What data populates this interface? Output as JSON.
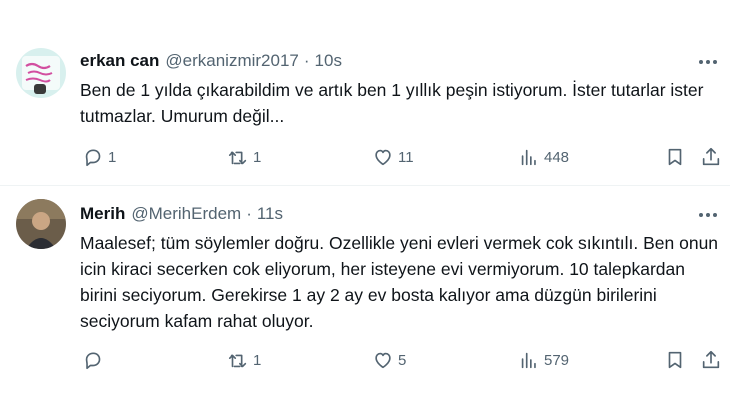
{
  "tweets": [
    {
      "author_name": "erkan can",
      "handle": "@erkanizmir2017",
      "separator": "·",
      "time": "10s",
      "text": "Ben de 1 yılda çıkarabildim ve artık ben 1 yıllık peşin istiyorum. İster tutarlar ister tutmazlar. Umurum değil...",
      "replies": "1",
      "retweets": "1",
      "likes": "11",
      "views": "448"
    },
    {
      "author_name": "Merih",
      "handle": "@MerihErdem",
      "separator": "·",
      "time": "11s",
      "text": "Maalesef; tüm söylemler doğru. Ozellikle yeni evleri vermek cok sıkıntılı. Ben onun icin kiraci secerken cok eliyorum, her isteyene evi vermiyorum. 10 talepkardan birini seciyorum. Gerekirse 1 ay 2 ay ev bosta kalıyor ama düzgün birilerini seciyorum kafam rahat oluyor.",
      "replies": "",
      "retweets": "1",
      "likes": "5",
      "views": "579"
    }
  ],
  "icons": [
    "more-icon",
    "reply-icon",
    "retweet-icon",
    "like-icon",
    "views-icon",
    "bookmark-icon",
    "share-icon"
  ],
  "colors": {
    "text": "#0f1419",
    "secondary": "#536471",
    "divider": "#eff3f4"
  }
}
